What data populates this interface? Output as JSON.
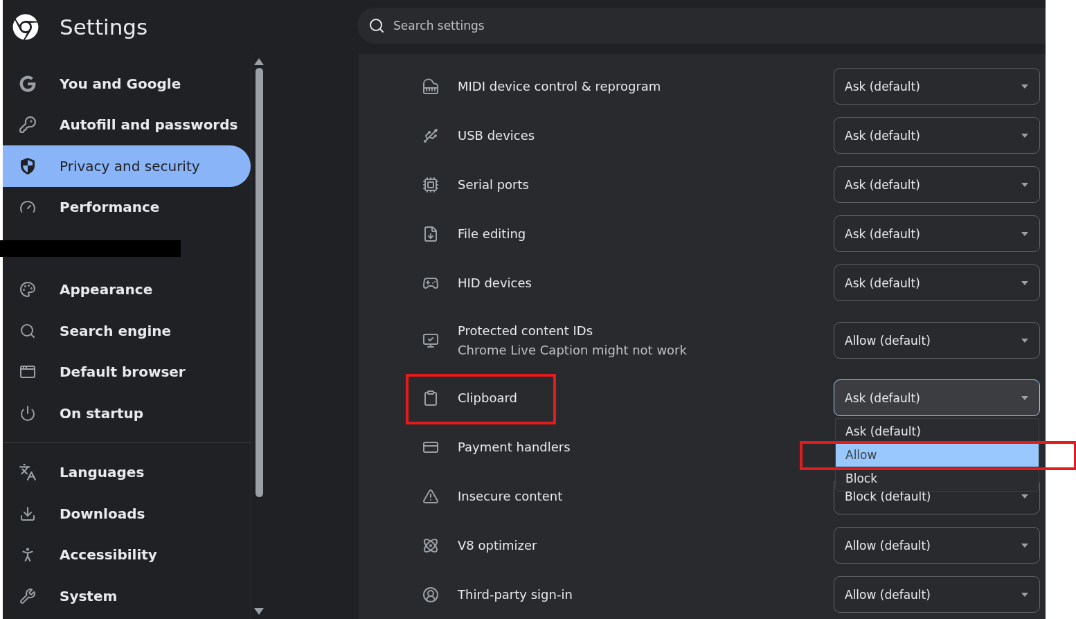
{
  "header": {
    "title": "Settings",
    "search": {
      "placeholder": "Search settings"
    }
  },
  "sidebar": {
    "items": [
      {
        "kind": "item",
        "label": "You and Google",
        "selected": false
      },
      {
        "kind": "item",
        "label": "Autofill and passwords",
        "selected": false
      },
      {
        "kind": "item",
        "label": "Privacy and security",
        "selected": true
      },
      {
        "kind": "item",
        "label": "Performance",
        "selected": false
      },
      {
        "kind": "redacted"
      },
      {
        "kind": "item",
        "label": "Appearance",
        "selected": false
      },
      {
        "kind": "item",
        "label": "Search engine",
        "selected": false
      },
      {
        "kind": "item",
        "label": "Default browser",
        "selected": false
      },
      {
        "kind": "item",
        "label": "On startup",
        "selected": false
      },
      {
        "kind": "divider"
      },
      {
        "kind": "item",
        "label": "Languages",
        "selected": false
      },
      {
        "kind": "item",
        "label": "Downloads",
        "selected": false
      },
      {
        "kind": "item",
        "label": "Accessibility",
        "selected": false
      },
      {
        "kind": "item",
        "label": "System",
        "selected": false
      }
    ]
  },
  "permissions": [
    {
      "label": "MIDI device control & reprogram",
      "value": "Ask (default)"
    },
    {
      "label": "USB devices",
      "value": "Ask (default)"
    },
    {
      "label": "Serial ports",
      "value": "Ask (default)"
    },
    {
      "label": "File editing",
      "value": "Ask (default)"
    },
    {
      "label": "HID devices",
      "value": "Ask (default)"
    },
    {
      "label": "Protected content IDs",
      "sublabel": "Chrome Live Caption might not work",
      "value": "Allow (default)"
    },
    {
      "label": "Clipboard",
      "value": "Ask (default)",
      "annotated": true,
      "open": true,
      "options": [
        {
          "label": "Ask (default)",
          "highlighted": false
        },
        {
          "label": "Allow",
          "highlighted": true,
          "annotated": true
        },
        {
          "label": "Block",
          "highlighted": false
        }
      ]
    },
    {
      "label": "Payment handlers"
    },
    {
      "label": "Insecure content",
      "value": "Block (default)"
    },
    {
      "label": "V8 optimizer",
      "value": "Allow (default)"
    },
    {
      "label": "Third-party sign-in",
      "value": "Allow (default)"
    }
  ]
}
